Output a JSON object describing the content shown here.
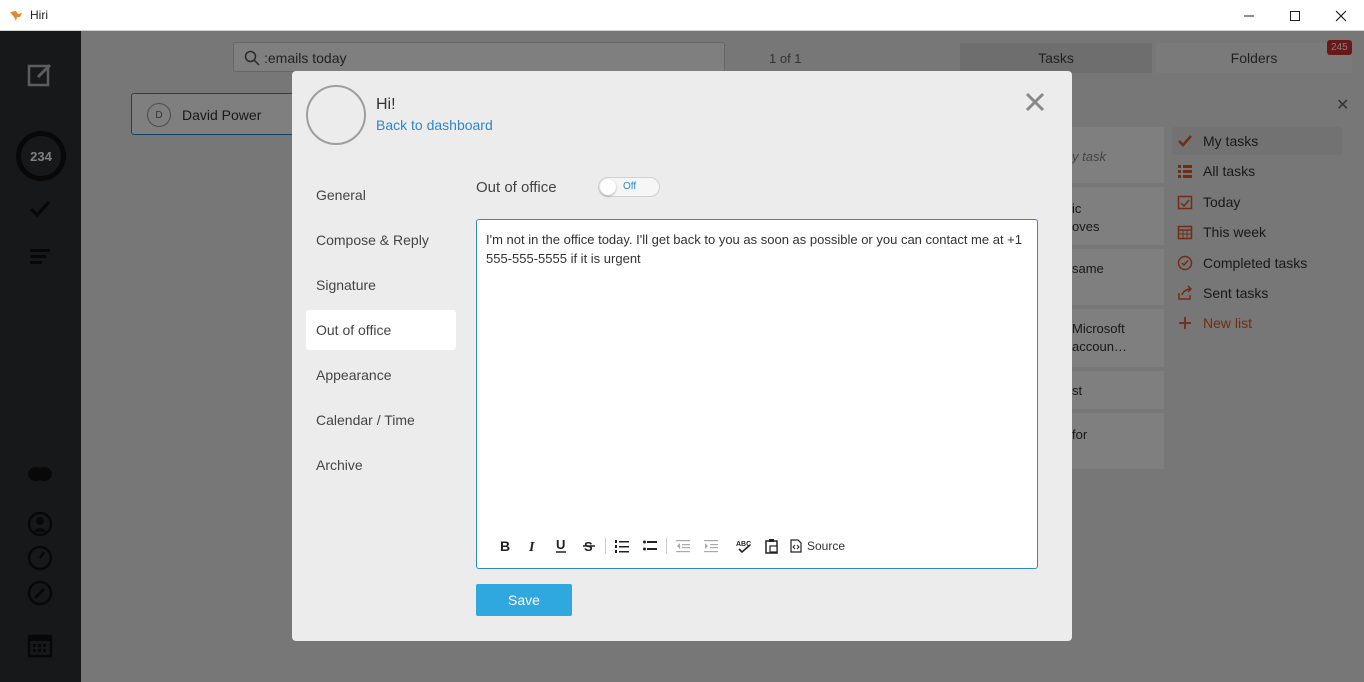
{
  "window": {
    "title": "Hiri"
  },
  "app": {
    "search": {
      "value": ":emails today"
    },
    "pager": "1 of 1",
    "tabs": {
      "tasks": "Tasks",
      "folders": "Folders"
    },
    "badge": "245",
    "rail": {
      "count": "234"
    },
    "contact": {
      "initial": "D",
      "name": "David Power"
    },
    "task_snippets": [
      "y task",
      "ic",
      "oves",
      "same",
      "Microsoft",
      "accoun…",
      "st",
      "for"
    ],
    "lists": [
      {
        "label": "My tasks"
      },
      {
        "label": "All tasks"
      },
      {
        "label": "Today"
      },
      {
        "label": "This week"
      },
      {
        "label": "Completed tasks"
      },
      {
        "label": "Sent tasks"
      },
      {
        "label": "New list"
      }
    ],
    "colors": {
      "accent": "#2f86c8",
      "orange": "#e05a2b",
      "rail": "#2d3035"
    }
  },
  "modal": {
    "greeting": "Hi!",
    "back_link": "Back to dashboard",
    "nav": [
      {
        "label": "General"
      },
      {
        "label": "Compose & Reply"
      },
      {
        "label": "Signature"
      },
      {
        "label": "Out of office"
      },
      {
        "label": "Appearance"
      },
      {
        "label": "Calendar / Time"
      },
      {
        "label": "Archive"
      }
    ],
    "out_of_office": {
      "label": "Out of office",
      "toggle_state": "Off",
      "message": "I'm not in the office today. I'll get back to you as soon as possible or you can contact me at +1 555-555-5555 if it is urgent"
    },
    "toolbar": {
      "source_label": "Source"
    },
    "save_label": "Save"
  }
}
